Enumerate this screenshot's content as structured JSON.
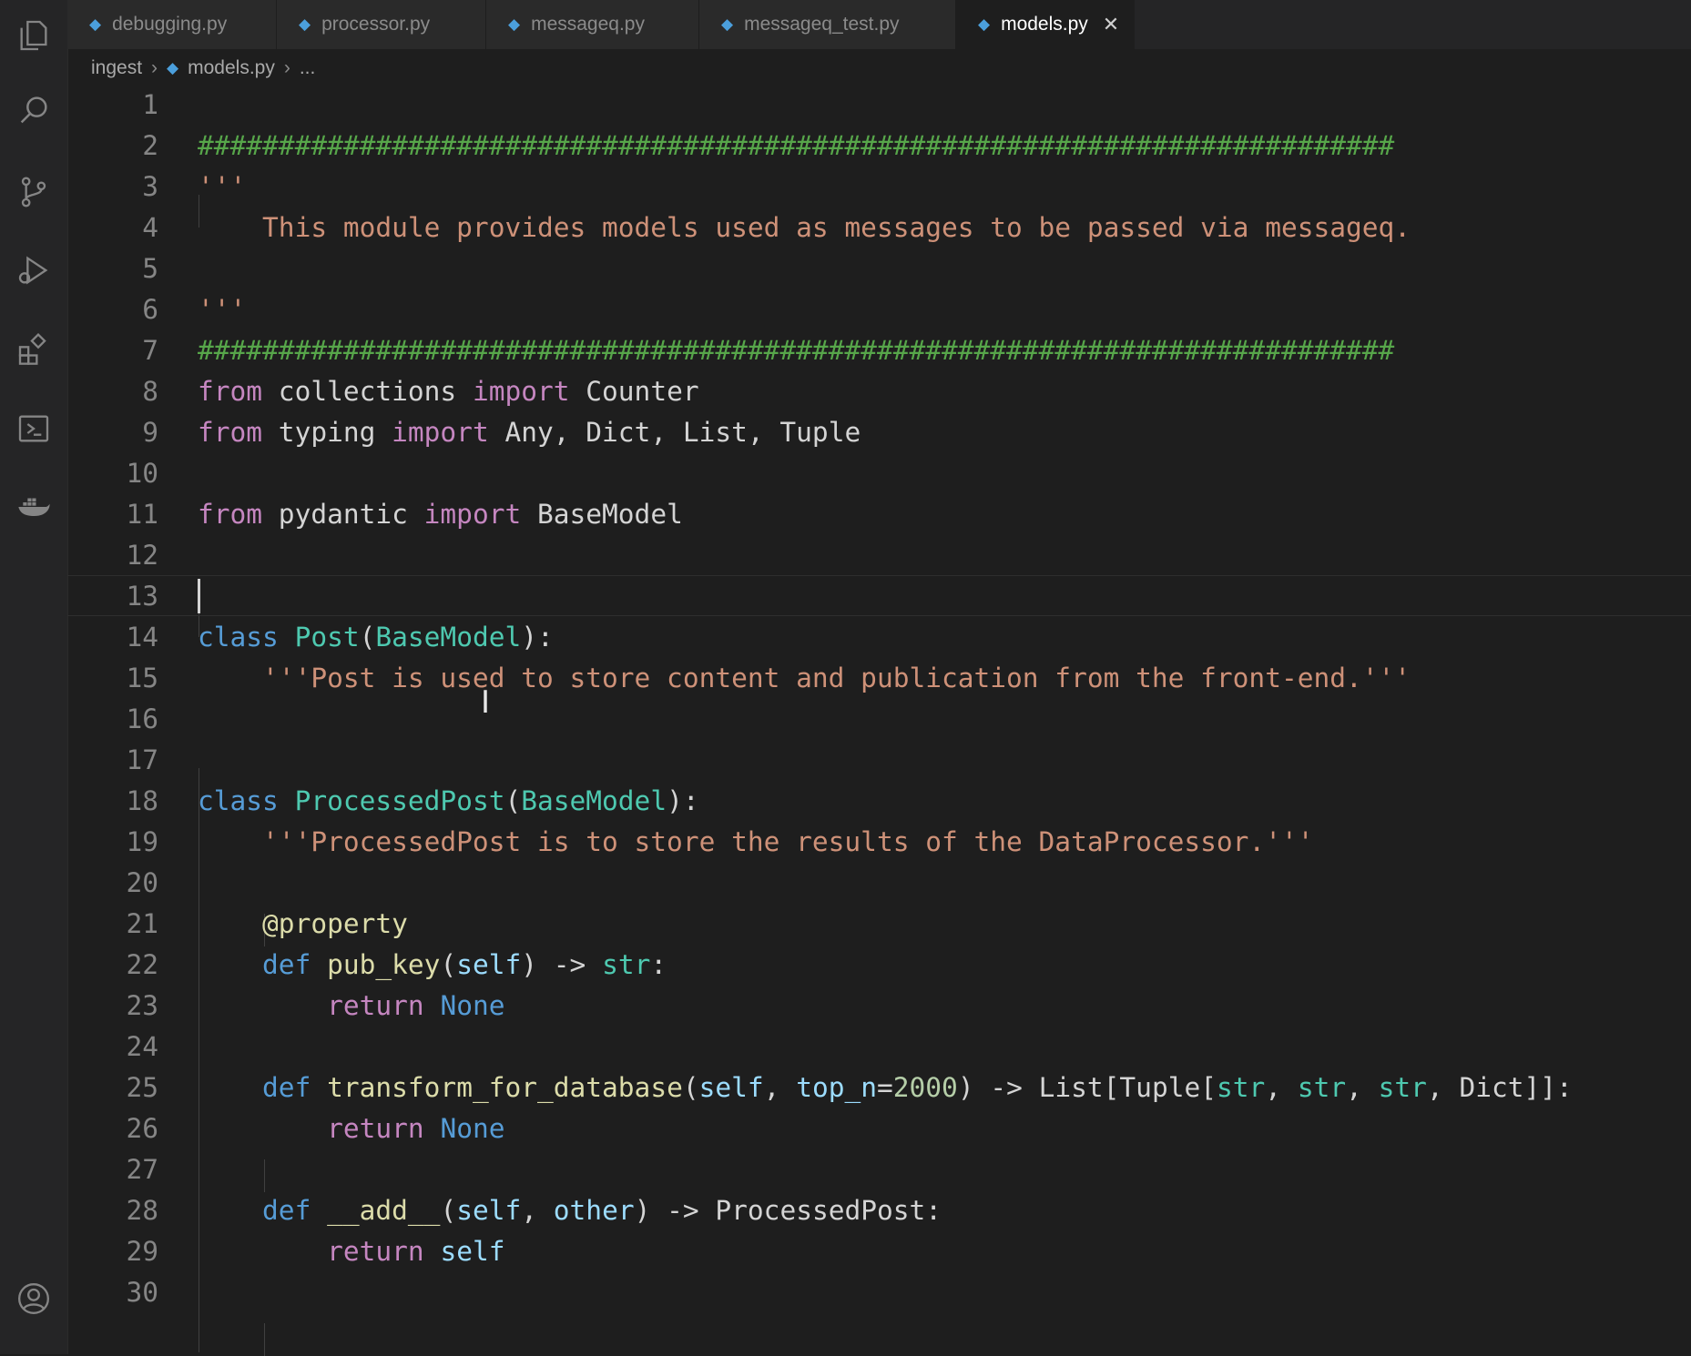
{
  "tabs": [
    {
      "label": "debugging.py",
      "active": false
    },
    {
      "label": "processor.py",
      "active": false
    },
    {
      "label": "messageq.py",
      "active": false
    },
    {
      "label": "messageq_test.py",
      "active": false
    },
    {
      "label": "models.py",
      "active": true
    }
  ],
  "breadcrumb": {
    "folder": "ingest",
    "file": "models.py",
    "more": "..."
  },
  "activity_icons": [
    "explorer-icon",
    "search-icon",
    "source-control-icon",
    "run-debug-icon",
    "extensions-icon",
    "remote-explorer-icon",
    "docker-icon",
    "account-icon"
  ],
  "colors": {
    "comment": "#57a64a",
    "string": "#ce9178",
    "keyword": "#c586c0",
    "class": "#4ec9b0",
    "function": "#dcdcaa",
    "param": "#9cdcfe"
  },
  "editor": {
    "current_line": 13,
    "lines": [
      {
        "n": "1",
        "text": ""
      },
      {
        "n": "2",
        "text": "##########################################################################"
      },
      {
        "n": "3",
        "text": "'''"
      },
      {
        "n": "4",
        "text": "    This module provides models used as messages to be passed via messageq."
      },
      {
        "n": "5",
        "text": ""
      },
      {
        "n": "6",
        "text": "'''"
      },
      {
        "n": "7",
        "text": "##########################################################################"
      },
      {
        "n": "8",
        "text": "from collections import Counter"
      },
      {
        "n": "9",
        "text": "from typing import Any, Dict, List, Tuple"
      },
      {
        "n": "10",
        "text": ""
      },
      {
        "n": "11",
        "text": "from pydantic import BaseModel"
      },
      {
        "n": "12",
        "text": ""
      },
      {
        "n": "13",
        "text": ""
      },
      {
        "n": "14",
        "text": "class Post(BaseModel):"
      },
      {
        "n": "15",
        "text": "    '''Post is used to store content and publication from the front-end.'''"
      },
      {
        "n": "16",
        "text": ""
      },
      {
        "n": "17",
        "text": ""
      },
      {
        "n": "18",
        "text": "class ProcessedPost(BaseModel):"
      },
      {
        "n": "19",
        "text": "    '''ProcessedPost is to store the results of the DataProcessor.'''"
      },
      {
        "n": "20",
        "text": ""
      },
      {
        "n": "21",
        "text": "    @property"
      },
      {
        "n": "22",
        "text": "    def pub_key(self) -> str:"
      },
      {
        "n": "23",
        "text": "        return None"
      },
      {
        "n": "24",
        "text": ""
      },
      {
        "n": "25",
        "text": "    def transform_for_database(self, top_n=2000) -> List[Tuple[str, str, str, Dict]]:"
      },
      {
        "n": "26",
        "text": "        return None"
      },
      {
        "n": "27",
        "text": ""
      },
      {
        "n": "28",
        "text": "    def __add__(self, other) -> ProcessedPost:"
      },
      {
        "n": "29",
        "text": "        return self"
      },
      {
        "n": "30",
        "text": ""
      }
    ]
  }
}
